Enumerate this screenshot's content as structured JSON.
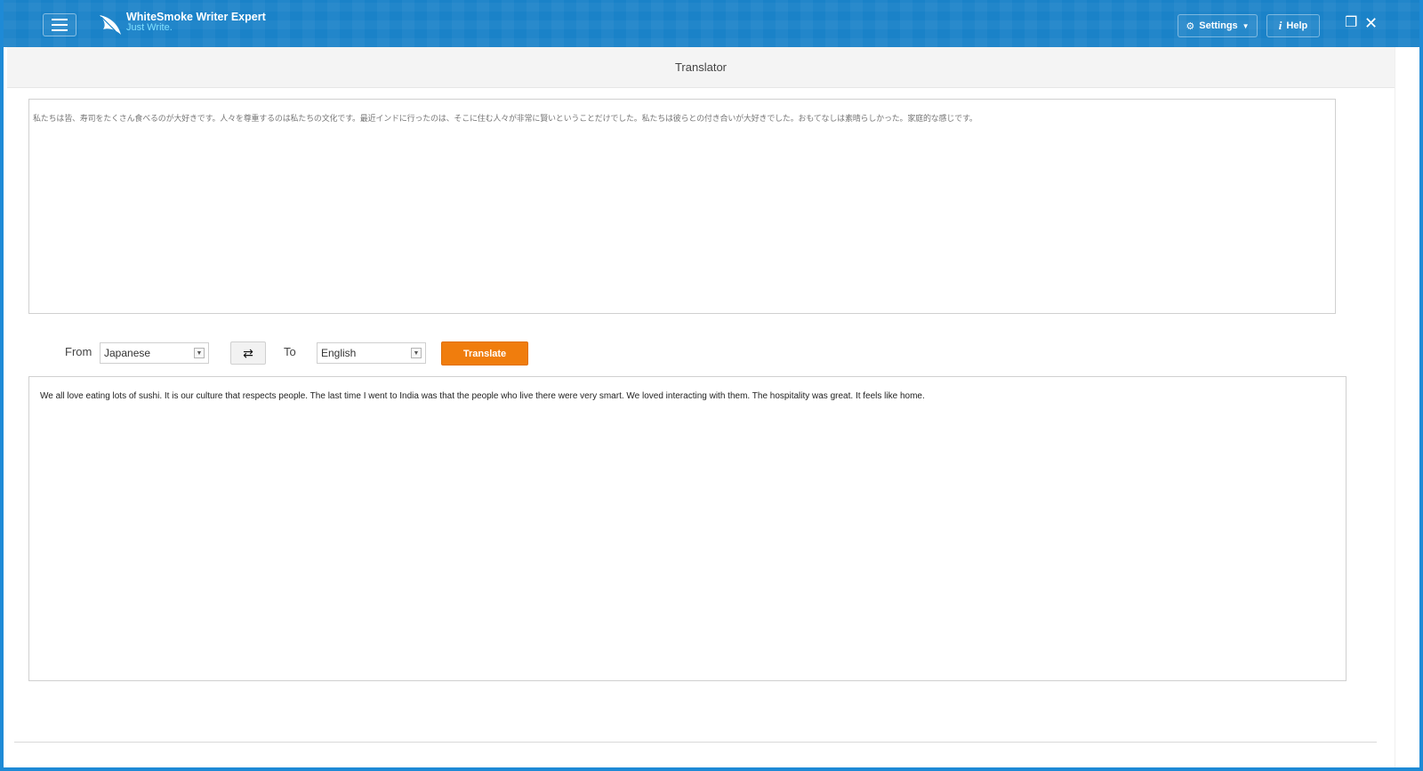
{
  "app": {
    "name": "WhiteSmoke Writer Expert",
    "tagline": "Just Write.",
    "accent_color": "#1a82c8",
    "translate_color": "#f07d0d"
  },
  "titlebar": {
    "settings_label": "Settings",
    "help_label": "Help",
    "icons": [
      "menu-icon",
      "gear-icon",
      "info-icon",
      "restore-icon",
      "close-icon"
    ]
  },
  "header": {
    "title": "Translator"
  },
  "source": {
    "text": "私たちは皆、寿司をたくさん食べるのが大好きです。人々を尊重するのは私たちの文化です。最近インドに行ったのは、そこに住む人々が非常に賢いということだけでした。私たちは彼らとの付き合いが大好きでした。おもてなしは素晴らしかった。家庭的な感じです。"
  },
  "controls": {
    "from_label": "From",
    "from_value": "Japanese",
    "to_label": "To",
    "to_value": "English",
    "translate_label": "Translate"
  },
  "output": {
    "text": "We all love eating lots of sushi. It is our culture that respects people. The last time I went to India was that the people who live there were very smart. We loved interacting with them. The hospitality was great. It feels like home."
  }
}
